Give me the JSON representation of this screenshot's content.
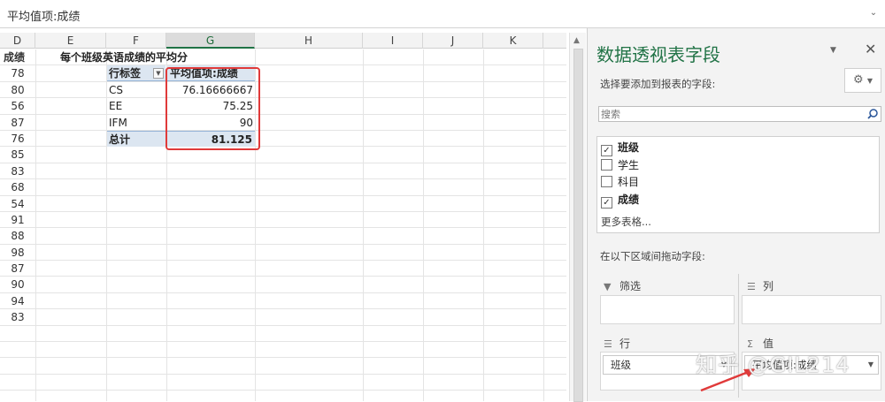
{
  "formula_bar": {
    "text": "平均值项:成绩"
  },
  "grid": {
    "columns": [
      "D",
      "E",
      "F",
      "G",
      "H",
      "I",
      "J",
      "K"
    ],
    "selected_column": "G",
    "d_header": "成绩",
    "d_values": [
      "78",
      "80",
      "56",
      "87",
      "76",
      "85",
      "83",
      "68",
      "54",
      "91",
      "88",
      "98",
      "87",
      "90",
      "94",
      "83"
    ],
    "title": "每个班级英语成绩的平均分",
    "pivot": {
      "row_label": "行标签",
      "value_label": "平均值项:成绩",
      "rows": [
        {
          "label": "CS",
          "value": "76.16666667"
        },
        {
          "label": "EE",
          "value": "75.25"
        },
        {
          "label": "IFM",
          "value": "90"
        }
      ],
      "total_label": "总计",
      "total_value": "81.125"
    }
  },
  "pane": {
    "title": "数据透视表字段",
    "subtitle": "选择要添加到报表的字段:",
    "search_placeholder": "搜索",
    "fields": [
      {
        "label": "班级",
        "checked": true
      },
      {
        "label": "学生",
        "checked": false
      },
      {
        "label": "科目",
        "checked": false
      },
      {
        "label": "成绩",
        "checked": true
      }
    ],
    "more_tables": "更多表格...",
    "drag_label": "在以下区域间拖动字段:",
    "areas": {
      "filter": "筛选",
      "columns": "列",
      "rows": "行",
      "values": "值"
    },
    "row_chip": "班级",
    "value_chip": "平均值项:成绩"
  },
  "watermark": "知乎 @GIL214",
  "colors": {
    "accent": "#217346",
    "highlight": "#e03a3a",
    "pivot_header": "#dce6f1"
  }
}
